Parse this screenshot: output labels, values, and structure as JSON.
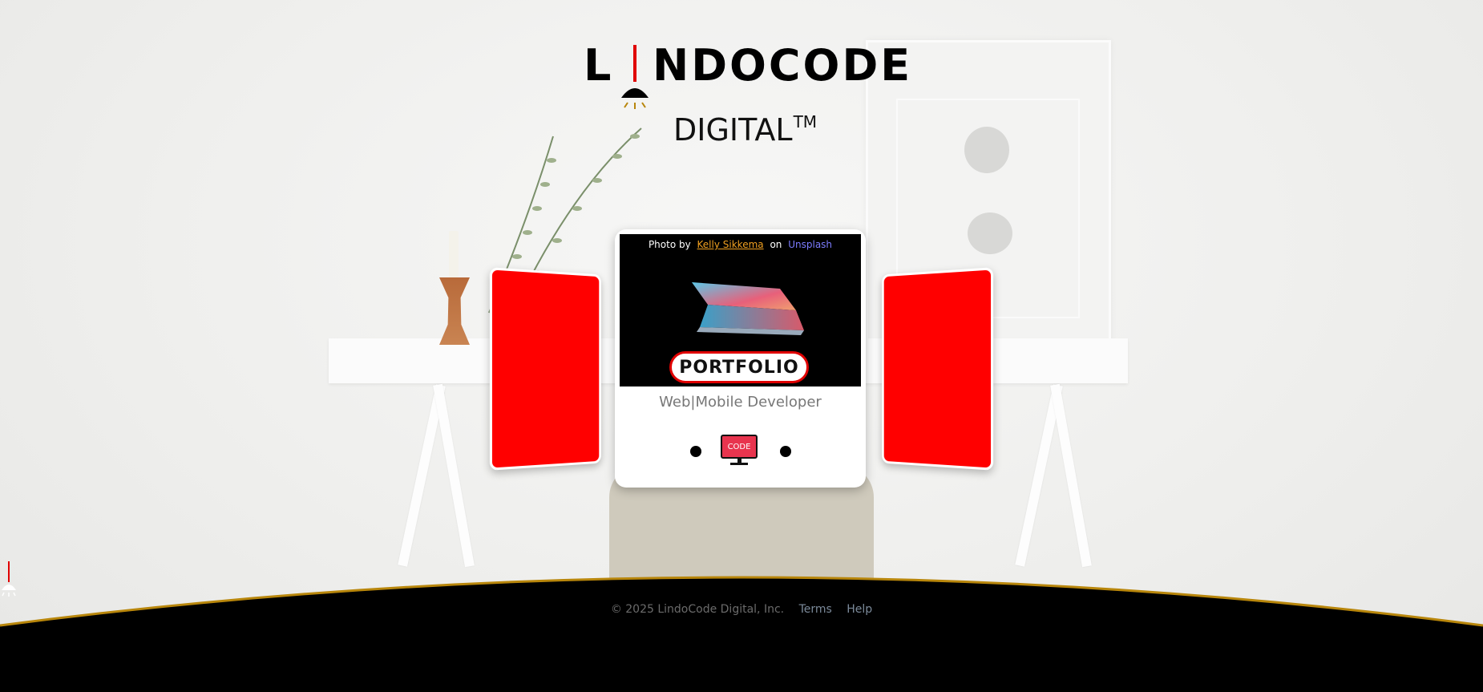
{
  "brand": {
    "logo_first_letter": "L",
    "logo_rest": "NDOCODE",
    "tagline_word": "DIGITAL",
    "trademark": "TM",
    "accent_color": "#e00000"
  },
  "carousel": {
    "photo_credit": {
      "prefix": "Photo by",
      "author": "Kelly Sikkema",
      "joiner": "on",
      "site": "Unsplash"
    },
    "card_button_label": "PORTFOLIO",
    "card_subtitle": "Web|Mobile Developer",
    "code_icon_label": "CODE",
    "side_card_color": "#ff0000"
  },
  "footer": {
    "copyright": "© 2025 LindoCode Digital, Inc.",
    "links": [
      "Terms",
      "Help"
    ],
    "curve_accent_color": "#b8860b"
  }
}
